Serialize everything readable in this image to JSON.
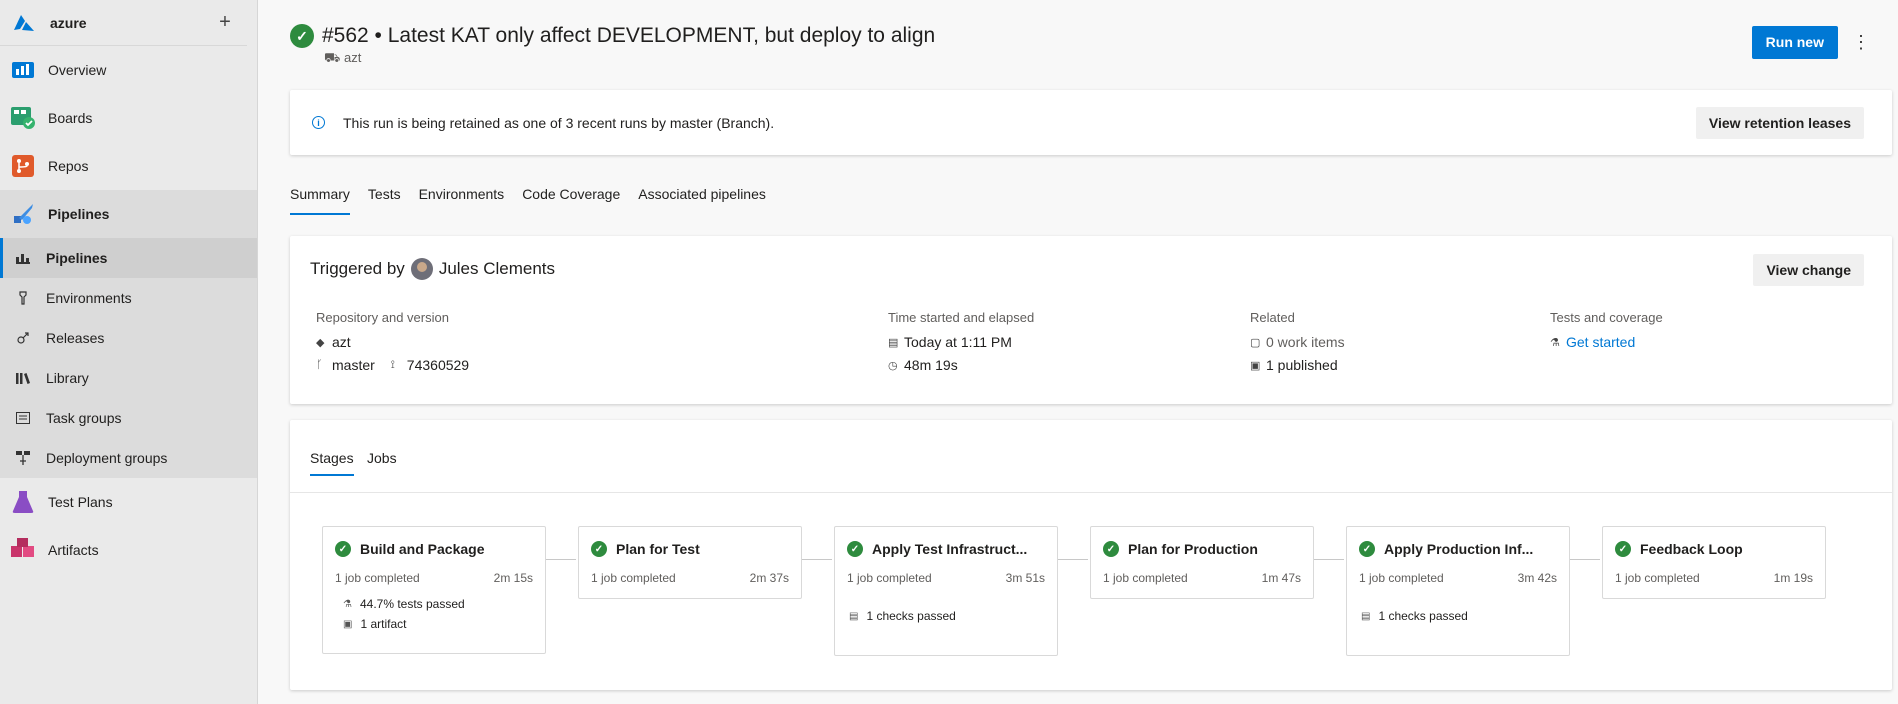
{
  "org": {
    "name": "azure",
    "add": "+"
  },
  "nav": {
    "overview": "Overview",
    "boards": "Boards",
    "repos": "Repos",
    "pipelines_group": "Pipelines",
    "sub": [
      "Pipelines",
      "Environments",
      "Releases",
      "Library",
      "Task groups",
      "Deployment groups"
    ],
    "test_plans": "Test Plans",
    "artifacts": "Artifacts"
  },
  "header": {
    "title": "#562 • Latest KAT only affect DEVELOPMENT, but deploy to align",
    "subtitle": "azt",
    "run_new": "Run new",
    "more": "⋮"
  },
  "banner": {
    "text": "This run is being retained as one of 3 recent runs by master (Branch).",
    "button": "View retention leases"
  },
  "tabs": [
    "Summary",
    "Tests",
    "Environments",
    "Code Coverage",
    "Associated pipelines"
  ],
  "summary": {
    "triggered_by": "Triggered by",
    "user": "Jules Clements",
    "view_change": "View change",
    "repo_label": "Repository and version",
    "repo_name": "azt",
    "branch": "master",
    "commit": "74360529",
    "time_label": "Time started and elapsed",
    "started": "Today at 1:11 PM",
    "elapsed": "48m 19s",
    "related_label": "Related",
    "work_items": "0 work items",
    "published": "1 published",
    "tests_label": "Tests and coverage",
    "get_started": "Get started"
  },
  "stage_tabs": [
    "Stages",
    "Jobs"
  ],
  "stages": [
    {
      "name": "Build and Package",
      "jobs": "1 job completed",
      "duration": "2m 15s",
      "extras": [
        "44.7% tests passed",
        "1 artifact"
      ]
    },
    {
      "name": "Plan for Test",
      "jobs": "1 job completed",
      "duration": "2m 37s",
      "extras": []
    },
    {
      "name": "Apply Test Infrastruct...",
      "jobs": "1 job completed",
      "duration": "3m 51s",
      "extras": [
        "1 checks passed"
      ]
    },
    {
      "name": "Plan for Production",
      "jobs": "1 job completed",
      "duration": "1m 47s",
      "extras": []
    },
    {
      "name": "Apply Production Inf...",
      "jobs": "1 job completed",
      "duration": "3m 42s",
      "extras": [
        "1 checks passed"
      ]
    },
    {
      "name": "Feedback Loop",
      "jobs": "1 job completed",
      "duration": "1m 19s",
      "extras": []
    }
  ],
  "colors": {
    "accent": "#0078d4",
    "success": "#2e8b3e"
  }
}
